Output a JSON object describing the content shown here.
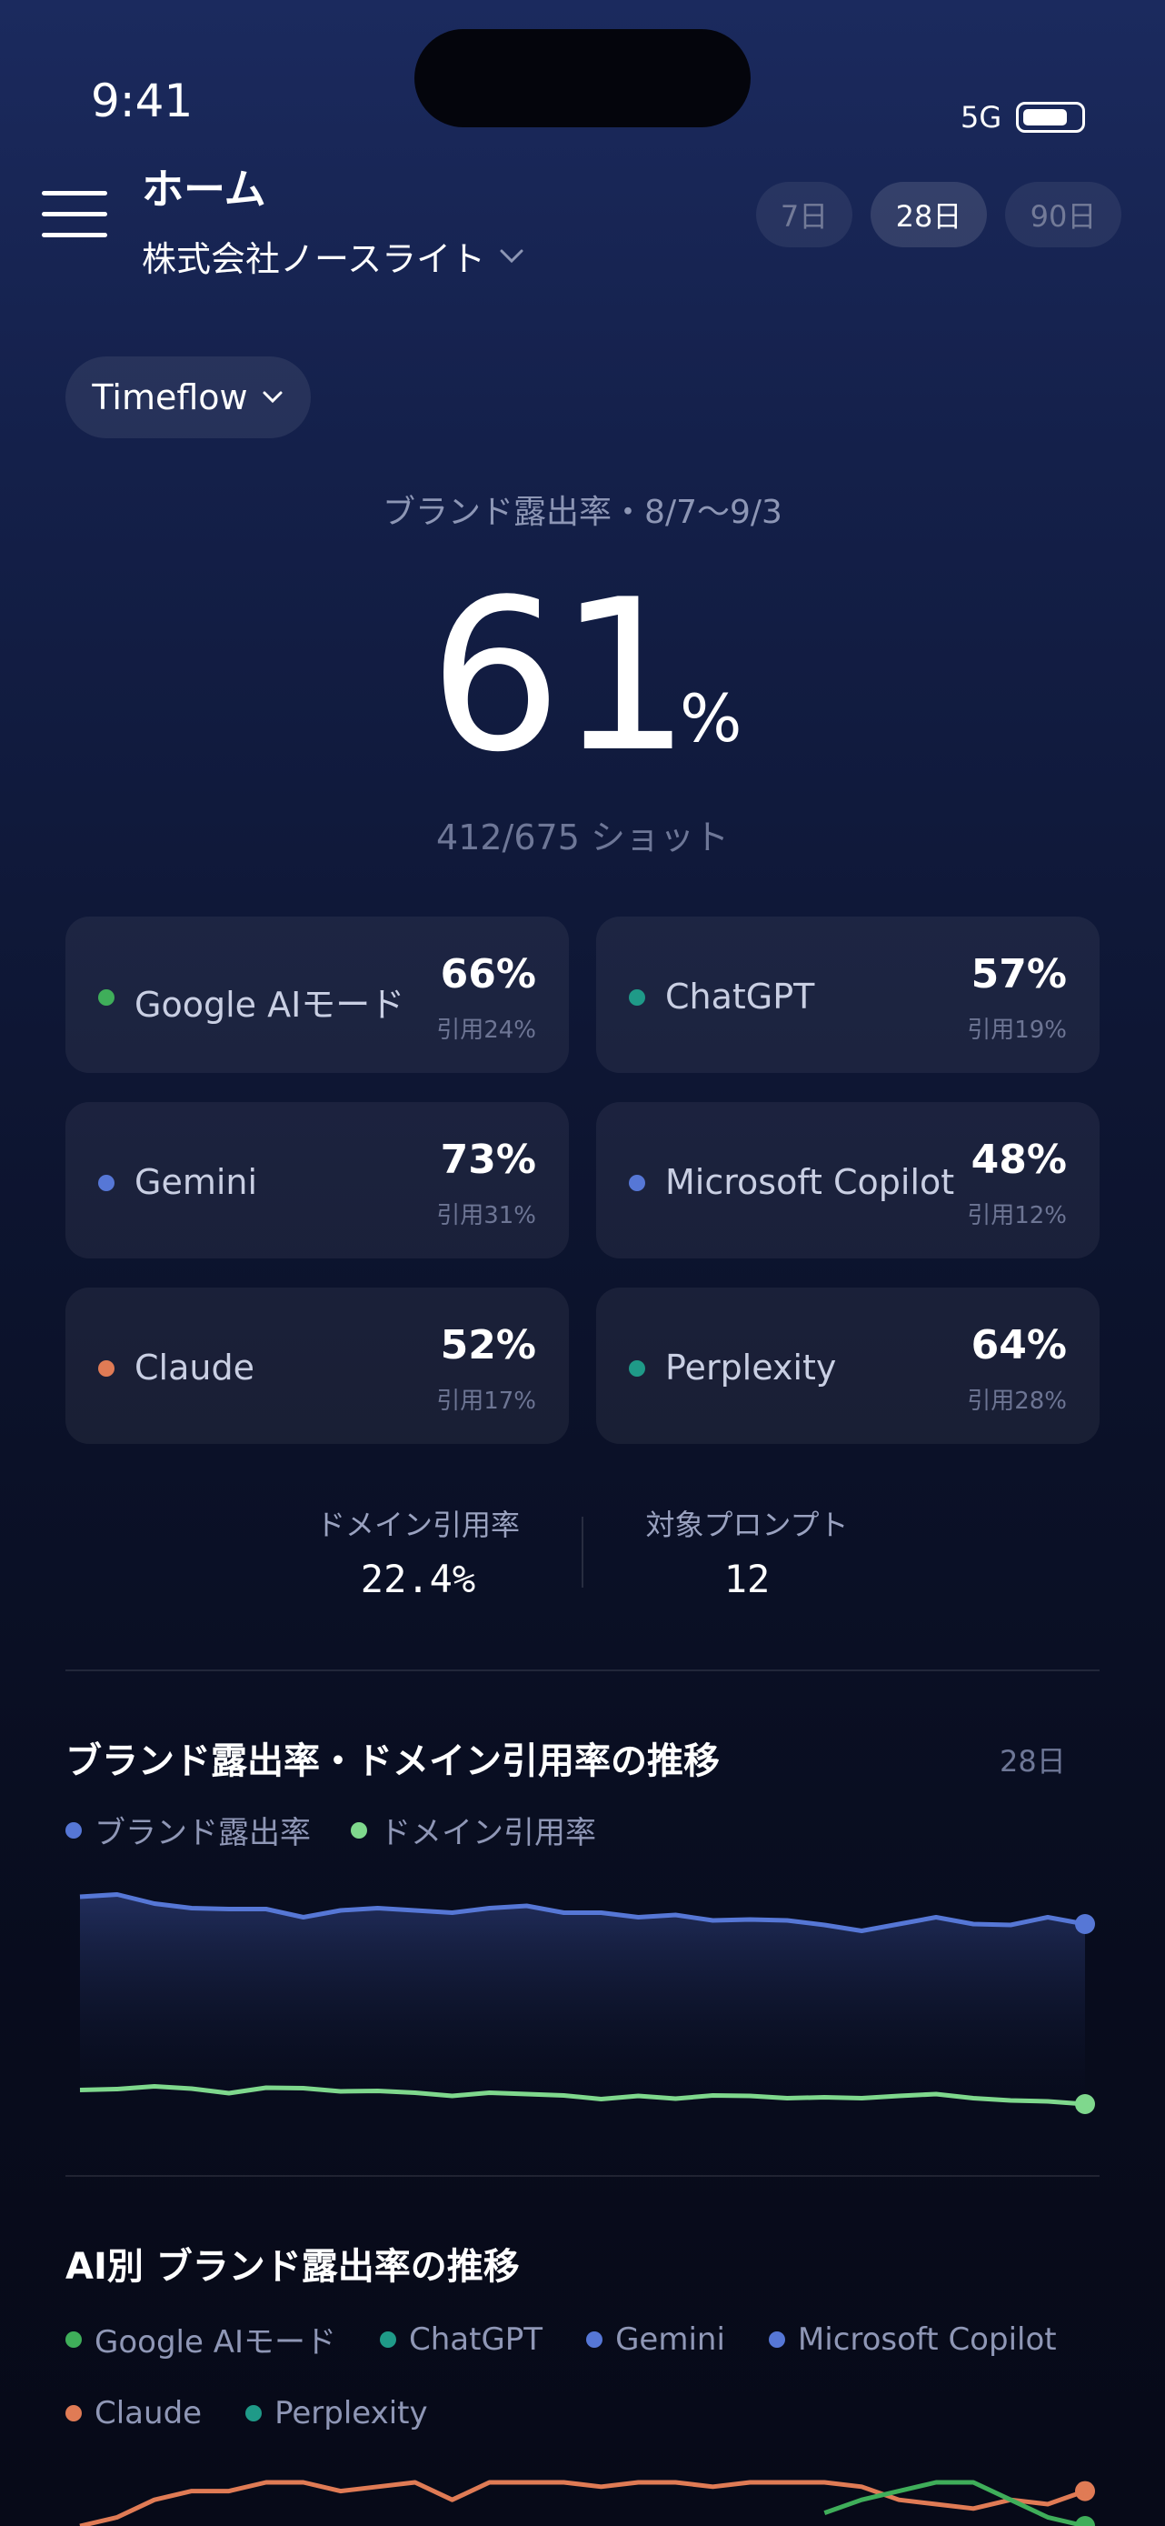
{
  "status": {
    "time": "9:41",
    "network": "5G"
  },
  "header": {
    "title": "ホーム",
    "company": "株式会社ノースライト",
    "ranges": [
      "7日",
      "28日",
      "90日"
    ],
    "active_range": "28日"
  },
  "view_select": {
    "label": "Timeflow"
  },
  "summary": {
    "label": "ブランド露出率・8/7〜9/3",
    "value": "61",
    "unit": "%",
    "shots": "412/675 ショット"
  },
  "engines": [
    {
      "name": "Google AIモード",
      "pct": "66%",
      "cite": "引用24%",
      "color": "#3fae5a"
    },
    {
      "name": "ChatGPT",
      "pct": "57%",
      "cite": "引用19%",
      "color": "#1f9a88"
    },
    {
      "name": "Gemini",
      "pct": "73%",
      "cite": "引用31%",
      "color": "#5677d6"
    },
    {
      "name": "Microsoft Copilot",
      "pct": "48%",
      "cite": "引用12%",
      "color": "#5677d6"
    },
    {
      "name": "Claude",
      "pct": "52%",
      "cite": "引用17%",
      "color": "#e07b55"
    },
    {
      "name": "Perplexity",
      "pct": "64%",
      "cite": "引用28%",
      "color": "#1f9a88"
    }
  ],
  "stats": {
    "domain_cite_label": "ドメイン引用率",
    "domain_cite_value": "22.4%",
    "prompts_label": "対象プロンプト",
    "prompts_value": "12"
  },
  "trend_section": {
    "title": "ブランド露出率・ドメイン引用率の推移",
    "days": "28日",
    "legend": [
      {
        "name": "ブランド露出率",
        "color": "#5677d6"
      },
      {
        "name": "ドメイン引用率",
        "color": "#7fd88d"
      }
    ]
  },
  "ai_section": {
    "title": "AI別 ブランド露出率の推移",
    "legend_row1": [
      {
        "name": "Google AIモード",
        "color": "#3fae5a"
      },
      {
        "name": "ChatGPT",
        "color": "#1f9a88"
      },
      {
        "name": "Gemini",
        "color": "#5677d6"
      },
      {
        "name": "Microsoft Copilot",
        "color": "#5677d6"
      }
    ],
    "legend_row2": [
      {
        "name": "Claude",
        "color": "#e07b55"
      },
      {
        "name": "Perplexity",
        "color": "#1f9a88"
      }
    ]
  },
  "chart_data": [
    {
      "type": "area",
      "title": "ブランド露出率・ドメイン引用率の推移",
      "x": [
        1,
        2,
        3,
        4,
        5,
        6,
        7,
        8,
        9,
        10,
        11,
        12,
        13,
        14,
        15,
        16,
        17,
        18,
        19,
        20,
        21,
        22,
        23,
        24,
        25,
        26,
        27,
        28
      ],
      "series": [
        {
          "name": "ブランド露出率",
          "color": "#5677d6",
          "values": [
            68,
            68.5,
            66.5,
            65.5,
            65.3,
            65.3,
            63.5,
            65,
            65.5,
            65,
            64.5,
            65.5,
            66,
            64.5,
            64.5,
            63.5,
            64,
            62.8,
            63,
            62.8,
            61.8,
            60.5,
            62,
            63.5,
            62,
            61.8,
            63.5,
            62
          ]
        },
        {
          "name": "ドメイン引用率",
          "color": "#7fd88d",
          "values": [
            25.5,
            25.7,
            26.3,
            25.8,
            24.8,
            26,
            25.9,
            25.2,
            25.3,
            24.9,
            24.2,
            24.9,
            24.6,
            24.3,
            23.5,
            24.2,
            23.6,
            24.3,
            24.2,
            23.7,
            23.9,
            23.7,
            24.2,
            24.6,
            23.7,
            23.2,
            23,
            22.4
          ]
        }
      ],
      "ylim": [
        0,
        100
      ]
    },
    {
      "type": "line",
      "title": "AI別 ブランド露出率の推移",
      "x": [
        1,
        2,
        3,
        4,
        5,
        6,
        7,
        8,
        9,
        10,
        11,
        12,
        13,
        14,
        15,
        16,
        17,
        18,
        19,
        20,
        21,
        22,
        23,
        24,
        25,
        26,
        27,
        28
      ],
      "series": [
        {
          "name": "Claude",
          "color": "#e07b55",
          "values": [
            40,
            44,
            52,
            56,
            56,
            60,
            60,
            56,
            58,
            60,
            52,
            60,
            60,
            60,
            58,
            60,
            60,
            58,
            60,
            60,
            60,
            58,
            52,
            50,
            48,
            52,
            50,
            56
          ]
        },
        {
          "name": "Google AIモード",
          "color": "#3fae5a",
          "values": [
            null,
            null,
            null,
            null,
            null,
            null,
            null,
            null,
            null,
            null,
            null,
            null,
            null,
            null,
            null,
            null,
            null,
            null,
            null,
            null,
            46,
            52,
            56,
            60,
            60,
            52,
            44,
            40
          ]
        }
      ],
      "ylim": [
        40,
        80
      ]
    }
  ]
}
